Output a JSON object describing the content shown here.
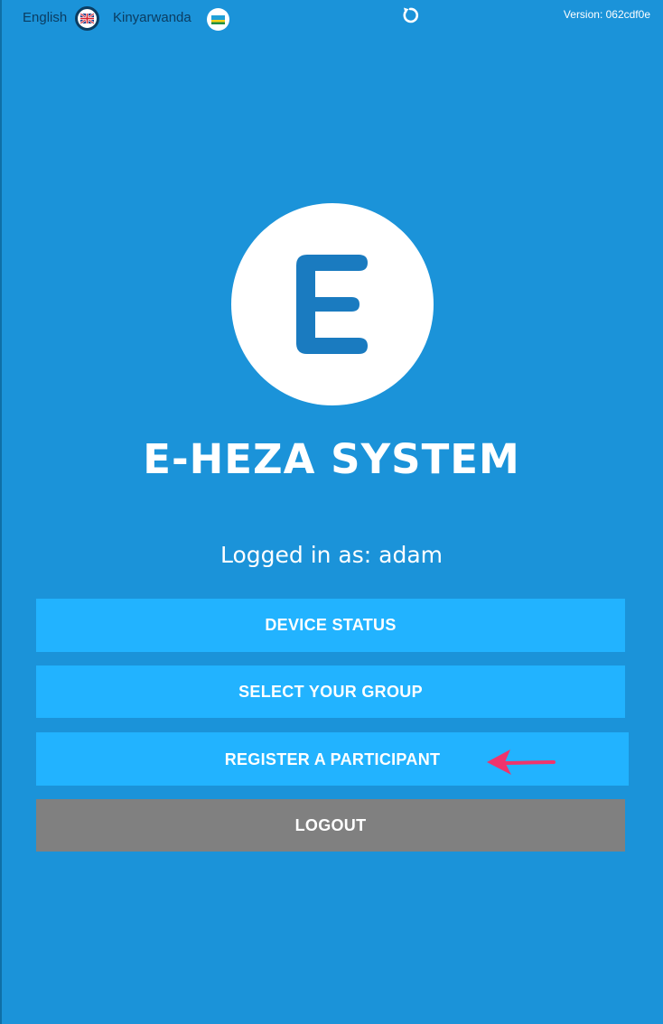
{
  "topbar": {
    "languages": [
      {
        "label": "English",
        "flag_icon": "uk-flag-icon"
      },
      {
        "label": "Kinyarwanda",
        "flag_icon": "rwanda-flag-icon"
      }
    ],
    "refresh_icon": "refresh-icon",
    "version": "Version: 062cdf0e"
  },
  "logo": {
    "letter": "E"
  },
  "app_title": "E-HEZA SYSTEM",
  "logged_in": "Logged in as: adam",
  "buttons": {
    "device_status": "DEVICE STATUS",
    "select_group": "SELECT YOUR GROUP",
    "register_participant": "REGISTER A PARTICIPANT",
    "logout": "LOGOUT"
  },
  "colors": {
    "background": "#1b93d9",
    "button_primary": "#22b3ff",
    "button_logout": "#808080",
    "logo_letter": "#1a7bc0",
    "annotation_arrow": "#f0346c"
  }
}
